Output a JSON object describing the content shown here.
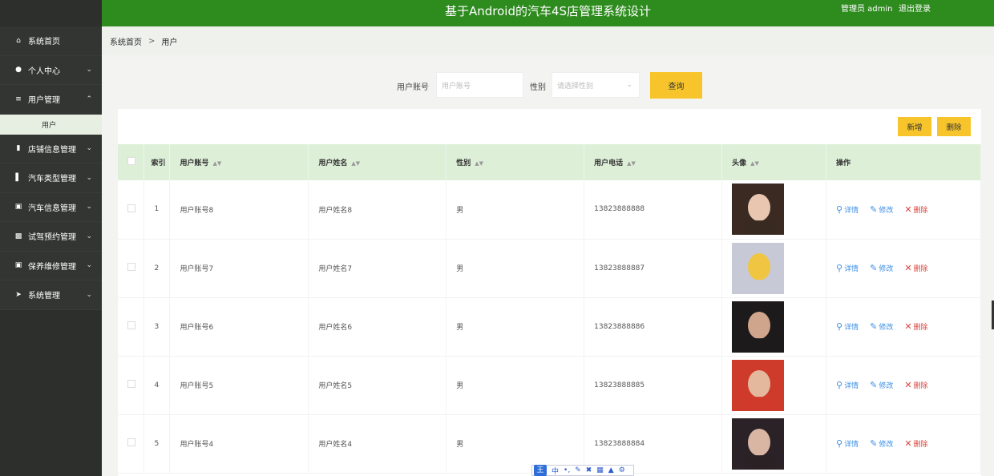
{
  "app": {
    "title": "基于Android的汽车4S店管理系统设计",
    "user_label": "管理员 admin",
    "logout_label": "退出登录"
  },
  "sidebar": {
    "items": [
      {
        "label": "系统首页",
        "icon": "home-icon",
        "has_chevron": false
      },
      {
        "label": "个人中心",
        "icon": "user-icon",
        "has_chevron": true
      },
      {
        "label": "用户管理",
        "icon": "sliders-icon",
        "has_chevron": true,
        "expanded": true
      },
      {
        "label": "店铺信息管理",
        "icon": "card-icon",
        "has_chevron": true
      },
      {
        "label": "汽车类型管理",
        "icon": "bar-chart-icon",
        "has_chevron": true
      },
      {
        "label": "汽车信息管理",
        "icon": "monitor-icon",
        "has_chevron": true
      },
      {
        "label": "试驾预约管理",
        "icon": "briefcase-icon",
        "has_chevron": true
      },
      {
        "label": "保养维修管理",
        "icon": "monitor-icon",
        "has_chevron": true
      },
      {
        "label": "系统管理",
        "icon": "send-icon",
        "has_chevron": true
      }
    ],
    "submenu": {
      "label": "用户"
    }
  },
  "breadcrumb": {
    "home": "系统首页",
    "separator": ">",
    "current": "用户"
  },
  "search": {
    "account_label": "用户账号",
    "account_placeholder": "用户账号",
    "gender_label": "性别",
    "gender_placeholder": "请选择性别",
    "query_button": "查询"
  },
  "actions": {
    "add": "新增",
    "delete": "删除"
  },
  "table": {
    "headers": [
      "索引",
      "用户账号",
      "用户姓名",
      "性别",
      "用户电话",
      "头像",
      "操作"
    ],
    "ops": {
      "detail": "详情",
      "edit": "修改",
      "delete": "删除"
    },
    "rows": [
      {
        "index": "1",
        "account": "用户账号8",
        "name": "用户姓名8",
        "gender": "男",
        "phone": "13823888888"
      },
      {
        "index": "2",
        "account": "用户账号7",
        "name": "用户姓名7",
        "gender": "男",
        "phone": "13823888887"
      },
      {
        "index": "3",
        "account": "用户账号6",
        "name": "用户姓名6",
        "gender": "男",
        "phone": "13823888886"
      },
      {
        "index": "4",
        "account": "用户账号5",
        "name": "用户姓名5",
        "gender": "男",
        "phone": "13823888885"
      },
      {
        "index": "5",
        "account": "用户账号4",
        "name": "用户姓名4",
        "gender": "男",
        "phone": "13823888884"
      }
    ]
  },
  "ime_toolbar": {
    "brand": "王",
    "mode": "中"
  },
  "colors": {
    "topbar": "#2e8b1e",
    "sidebar": "#2d2f2d",
    "accent": "#f7c52b",
    "table_header": "#deefd8",
    "link": "#3a8ee6",
    "danger": "#d9453d"
  }
}
